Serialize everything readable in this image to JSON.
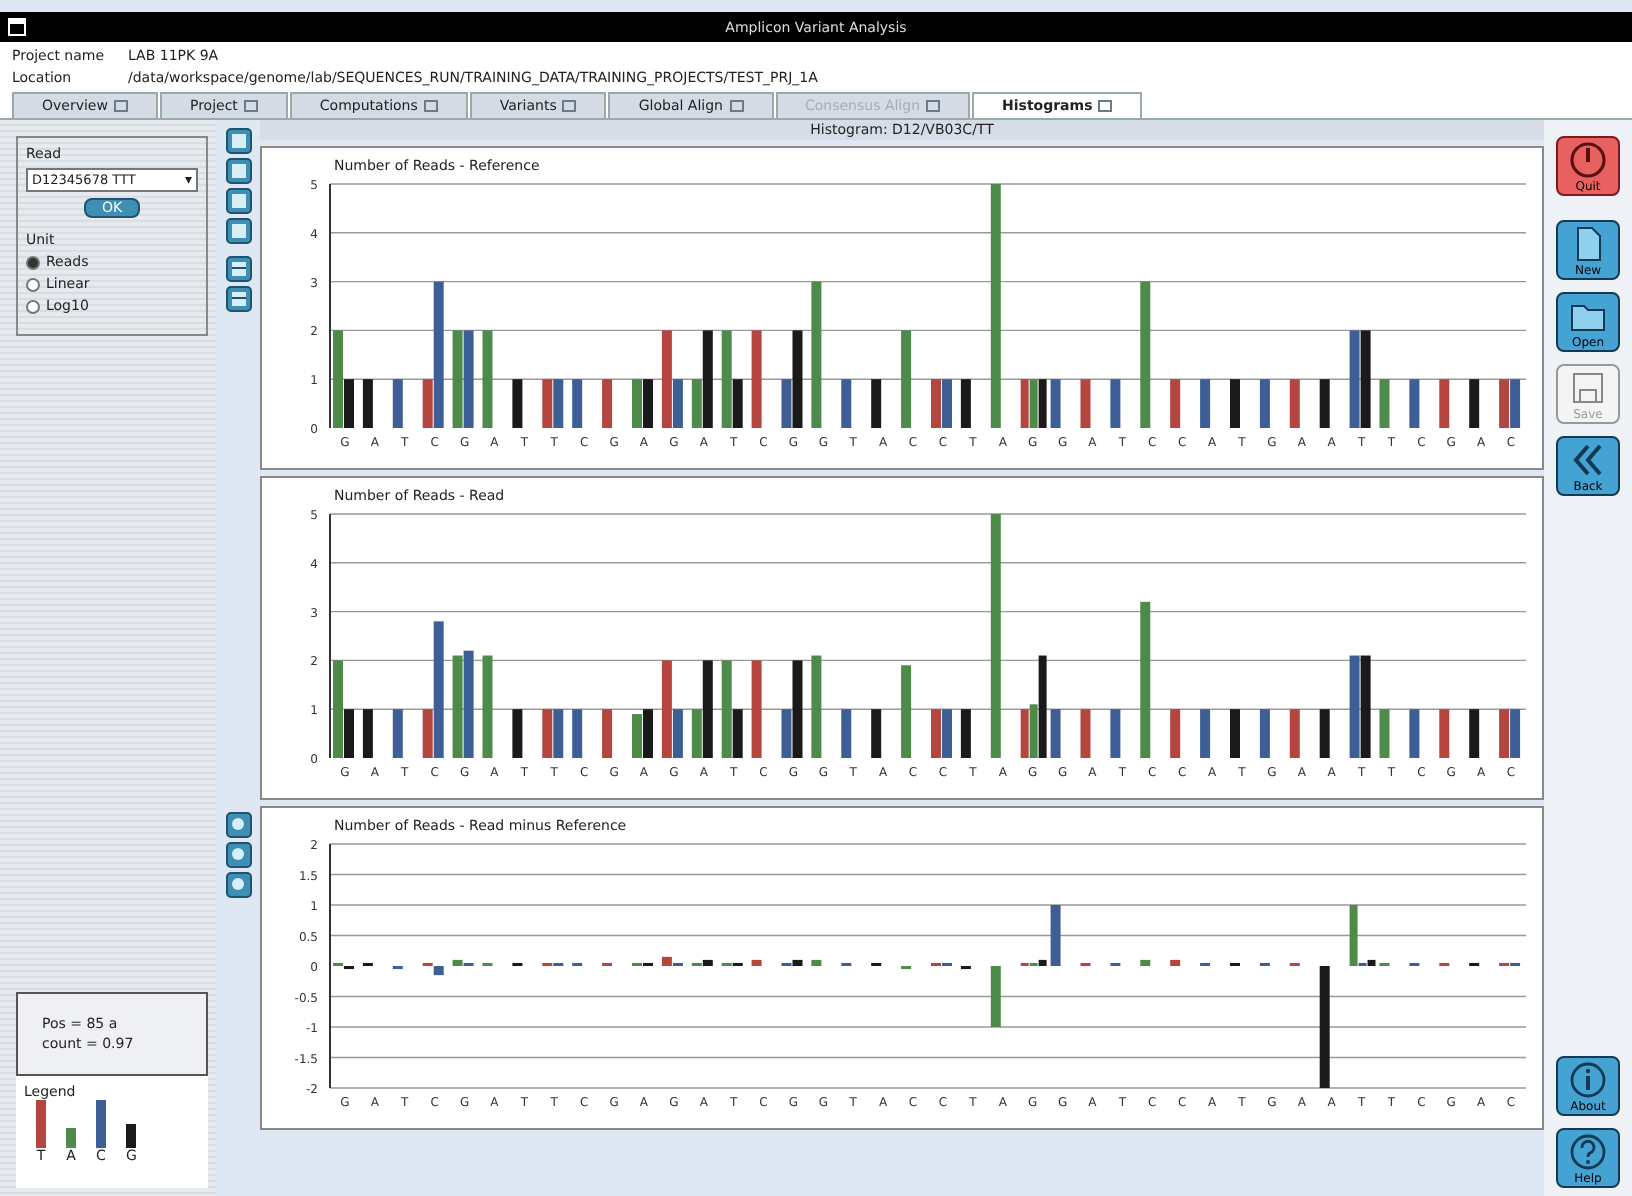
{
  "window": {
    "title": "Amplicon Variant Analysis"
  },
  "project": {
    "name_label": "Project name",
    "name_value": "LAB 11PK 9A",
    "location_label": "Location",
    "location_value": "/data/workspace/genome/lab/SEQUENCES_RUN/TRAINING_DATA/TRAINING_PROJECTS/TEST_PRJ_1A"
  },
  "tabs": [
    {
      "label": "Overview",
      "selected": false,
      "disabled": false
    },
    {
      "label": "Project",
      "selected": false,
      "disabled": false
    },
    {
      "label": "Computations",
      "selected": false,
      "disabled": false
    },
    {
      "label": "Variants",
      "selected": false,
      "disabled": false
    },
    {
      "label": "Global Align",
      "selected": false,
      "disabled": false
    },
    {
      "label": "Consensus Align",
      "selected": false,
      "disabled": true
    },
    {
      "label": "Histograms",
      "selected": true,
      "disabled": false
    }
  ],
  "histogram_header": {
    "label": "Histogram:",
    "value": "D12/VB03C/TT"
  },
  "read_panel": {
    "label": "Read",
    "value": "D12345678 TTT",
    "arrow": "▾",
    "button": "OK",
    "unit_label": "Unit",
    "units": [
      {
        "label": "Reads",
        "selected": true
      },
      {
        "label": "Linear",
        "selected": false
      },
      {
        "label": "Log10",
        "selected": false
      }
    ]
  },
  "stats": {
    "lines": [
      "Pos = 85 a",
      "count = 0.97"
    ]
  },
  "legend": {
    "title": "Legend",
    "items": [
      {
        "label": "T",
        "color": "#b4453f"
      },
      {
        "label": "A",
        "color": "#4e8a4a"
      },
      {
        "label": "C",
        "color": "#3e5f95"
      },
      {
        "label": "G",
        "color": "#1a1a1a"
      }
    ]
  },
  "charts": [
    {
      "chart_data": {
        "type": "bar",
        "title": "Number of Reads - Reference",
        "categories": [
          "G",
          "A",
          "T",
          "C",
          "G",
          "A",
          "T",
          "T",
          "C",
          "G",
          "A",
          "G",
          "A",
          "T",
          "C",
          "G",
          "G",
          "T",
          "A",
          "C",
          "C",
          "T",
          "A",
          "G",
          "G",
          "A",
          "T",
          "C",
          "C",
          "A",
          "T",
          "G",
          "A",
          "A",
          "T",
          "T",
          "C",
          "G",
          "A",
          "C"
        ],
        "ylim": [
          0,
          5
        ],
        "yticks": [
          0,
          1,
          2,
          3,
          4,
          5
        ],
        "grid": true,
        "series": [
          {
            "color": "#b4453f",
            "values": [
              null,
              null,
              null,
              1,
              null,
              null,
              null,
              1,
              null,
              1,
              null,
              2,
              null,
              null,
              2,
              null,
              null,
              null,
              null,
              null,
              1,
              null,
              null,
              1,
              null,
              1,
              null,
              null,
              1,
              null,
              null,
              null,
              1,
              null,
              null,
              null,
              null,
              1,
              null,
              1
            ]
          },
          {
            "color": "#4e8a4a",
            "values": [
              2,
              null,
              null,
              null,
              2,
              2,
              null,
              null,
              null,
              null,
              1,
              null,
              1,
              2,
              null,
              null,
              3,
              null,
              null,
              2,
              null,
              null,
              5,
              1,
              null,
              null,
              null,
              3,
              null,
              null,
              null,
              null,
              null,
              null,
              null,
              1,
              null,
              null,
              null,
              null
            ]
          },
          {
            "color": "#3e5f95",
            "values": [
              null,
              null,
              1,
              3,
              2,
              null,
              null,
              1,
              1,
              null,
              null,
              1,
              null,
              null,
              null,
              1,
              null,
              1,
              null,
              null,
              1,
              null,
              null,
              null,
              1,
              null,
              1,
              null,
              null,
              1,
              null,
              1,
              null,
              null,
              2,
              null,
              1,
              null,
              null,
              1
            ]
          },
          {
            "color": "#1a1a1a",
            "values": [
              1,
              1,
              null,
              null,
              null,
              null,
              1,
              null,
              null,
              null,
              1,
              null,
              2,
              1,
              null,
              2,
              null,
              null,
              1,
              null,
              null,
              1,
              null,
              1,
              null,
              null,
              null,
              null,
              null,
              null,
              1,
              null,
              null,
              1,
              2,
              null,
              null,
              null,
              1,
              null
            ]
          }
        ]
      }
    },
    {
      "chart_data": {
        "type": "bar",
        "title": "Number of Reads - Read",
        "categories": [
          "G",
          "A",
          "T",
          "C",
          "G",
          "A",
          "T",
          "T",
          "C",
          "G",
          "A",
          "G",
          "A",
          "T",
          "C",
          "G",
          "G",
          "T",
          "A",
          "C",
          "C",
          "T",
          "A",
          "G",
          "G",
          "A",
          "T",
          "C",
          "C",
          "A",
          "T",
          "G",
          "A",
          "A",
          "T",
          "T",
          "C",
          "G",
          "A",
          "C"
        ],
        "ylim": [
          0,
          5
        ],
        "yticks": [
          0,
          1,
          2,
          3,
          4,
          5
        ],
        "grid": true,
        "series": [
          {
            "color": "#b4453f",
            "values": [
              null,
              null,
              null,
              1,
              null,
              null,
              null,
              1,
              null,
              1,
              null,
              2,
              null,
              null,
              2,
              null,
              null,
              null,
              null,
              null,
              1,
              null,
              null,
              1,
              null,
              1,
              null,
              null,
              1,
              null,
              null,
              null,
              1,
              null,
              null,
              null,
              null,
              1,
              null,
              1
            ]
          },
          {
            "color": "#4e8a4a",
            "values": [
              2,
              null,
              null,
              null,
              2.1,
              2.1,
              null,
              null,
              null,
              null,
              0.9,
              null,
              1,
              2,
              null,
              null,
              2.1,
              null,
              null,
              1.9,
              null,
              null,
              5,
              1.1,
              null,
              null,
              null,
              3.2,
              null,
              null,
              null,
              null,
              null,
              null,
              null,
              1,
              null,
              null,
              null,
              null
            ]
          },
          {
            "color": "#3e5f95",
            "values": [
              null,
              null,
              1,
              2.8,
              2.2,
              null,
              null,
              1,
              1,
              null,
              null,
              1,
              null,
              null,
              null,
              1,
              null,
              1,
              null,
              null,
              1,
              null,
              null,
              null,
              1,
              null,
              1,
              null,
              null,
              1,
              null,
              1,
              null,
              null,
              2.1,
              null,
              1,
              null,
              null,
              1
            ]
          },
          {
            "color": "#1a1a1a",
            "values": [
              1,
              1,
              null,
              null,
              null,
              null,
              1,
              null,
              null,
              null,
              1,
              null,
              2,
              1,
              null,
              2,
              null,
              null,
              1,
              null,
              null,
              1,
              null,
              2.1,
              null,
              null,
              null,
              null,
              null,
              null,
              1,
              null,
              null,
              1,
              2.1,
              null,
              null,
              null,
              1,
              null
            ]
          }
        ]
      }
    },
    {
      "chart_data": {
        "type": "bar",
        "title": "Number of Reads - Read minus Reference",
        "categories": [
          "G",
          "A",
          "T",
          "C",
          "G",
          "A",
          "T",
          "T",
          "C",
          "G",
          "A",
          "G",
          "A",
          "T",
          "C",
          "G",
          "G",
          "T",
          "A",
          "C",
          "C",
          "T",
          "A",
          "G",
          "G",
          "A",
          "T",
          "C",
          "C",
          "A",
          "T",
          "G",
          "A",
          "A",
          "T",
          "T",
          "C",
          "G",
          "A",
          "C"
        ],
        "ylim": [
          -2,
          2
        ],
        "yticks": [
          -2,
          -1.5,
          -1,
          -0.5,
          0,
          0.5,
          1,
          1.5,
          2
        ],
        "grid": true,
        "series": [
          {
            "color": "#b4453f",
            "values": [
              null,
              null,
              null,
              0.05,
              null,
              null,
              null,
              0.05,
              null,
              0.05,
              null,
              0.15,
              null,
              null,
              0.1,
              null,
              null,
              null,
              null,
              null,
              0.05,
              null,
              null,
              0.05,
              null,
              0.05,
              null,
              null,
              0.1,
              null,
              null,
              null,
              0.05,
              null,
              null,
              null,
              null,
              0.05,
              null,
              0.05
            ]
          },
          {
            "color": "#4e8a4a",
            "values": [
              0.05,
              null,
              null,
              null,
              0.1,
              0.05,
              null,
              null,
              null,
              null,
              0.05,
              null,
              0.05,
              0.05,
              null,
              null,
              0.1,
              null,
              null,
              -0.05,
              null,
              null,
              -1,
              0.05,
              null,
              null,
              null,
              0.1,
              null,
              null,
              null,
              null,
              null,
              null,
              1,
              0.05,
              null,
              null,
              null,
              null
            ]
          },
          {
            "color": "#3e5f95",
            "values": [
              null,
              null,
              -0.05,
              -0.15,
              0.05,
              null,
              null,
              0.05,
              0.05,
              null,
              null,
              0.05,
              null,
              null,
              null,
              0.05,
              null,
              0.05,
              null,
              null,
              0.05,
              null,
              null,
              null,
              1,
              null,
              0.05,
              null,
              null,
              0.05,
              null,
              0.05,
              null,
              null,
              0.05,
              null,
              0.05,
              null,
              null,
              0.05
            ]
          },
          {
            "color": "#1a1a1a",
            "values": [
              -0.05,
              0.05,
              null,
              null,
              null,
              null,
              0.05,
              null,
              null,
              null,
              0.05,
              null,
              0.1,
              0.05,
              null,
              0.1,
              null,
              null,
              0.05,
              null,
              null,
              -0.05,
              null,
              0.1,
              null,
              null,
              null,
              null,
              null,
              null,
              0.05,
              null,
              null,
              -2,
              0.1,
              null,
              null,
              null,
              0.05,
              null
            ]
          }
        ]
      }
    }
  ],
  "toolbar": [
    {
      "label": "Quit",
      "kind": "quit",
      "disabled": false
    },
    {
      "label": "New",
      "kind": "new",
      "disabled": false
    },
    {
      "label": "Open",
      "kind": "open",
      "disabled": false
    },
    {
      "label": "Save",
      "kind": "save",
      "disabled": true
    },
    {
      "label": "Back",
      "kind": "back",
      "disabled": false
    },
    {
      "label": "About",
      "kind": "about",
      "disabled": false
    },
    {
      "label": "Help",
      "kind": "help",
      "disabled": false
    }
  ]
}
